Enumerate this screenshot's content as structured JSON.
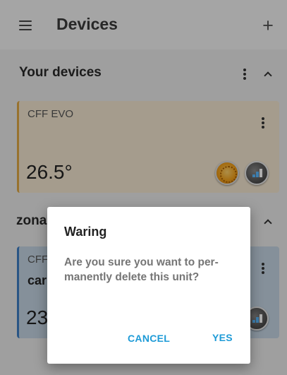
{
  "appbar": {
    "title": "Devices",
    "add_label": "+"
  },
  "sections": [
    {
      "title": "Your devices"
    },
    {
      "title": "zona"
    }
  ],
  "devices": [
    {
      "name": "CFF EVO",
      "temperature": "26.5°",
      "accent": "#e0a845"
    },
    {
      "name": "CFF",
      "subtitle": "car",
      "temperature": "23",
      "accent": "#3d7ec4"
    }
  ],
  "dialog": {
    "title": "Waring",
    "message": "Are you sure you want to per-manently delete this unit?",
    "cancel_label": "CANCEL",
    "yes_label": "YES",
    "accent": "#1e9bd7"
  }
}
